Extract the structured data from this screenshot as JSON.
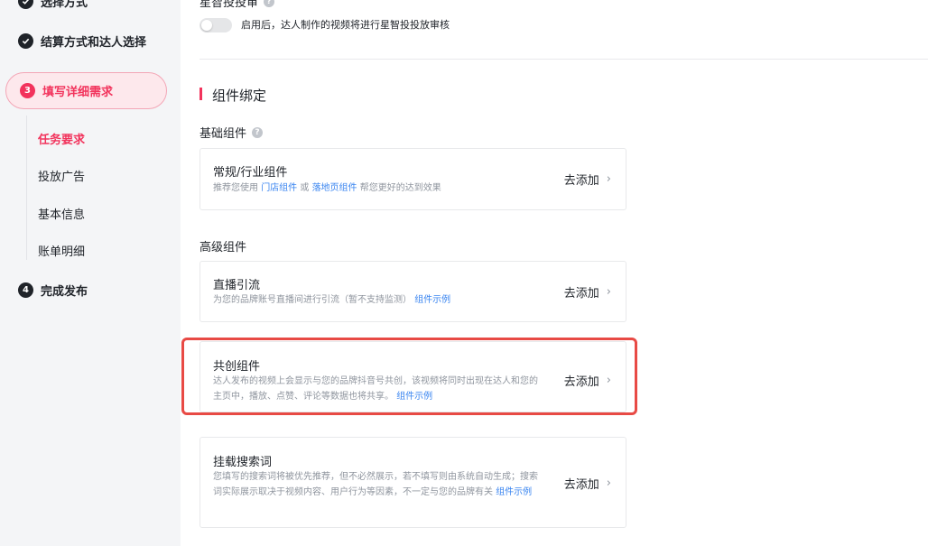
{
  "sidebar": {
    "steps": [
      {
        "label": "选择方式"
      },
      {
        "label": "结算方式和达人选择"
      },
      {
        "number": "3",
        "label": "填写详细需求"
      },
      {
        "number": "4",
        "label": "完成发布"
      }
    ],
    "sub_items": [
      {
        "label": "任务要求"
      },
      {
        "label": "投放广告"
      },
      {
        "label": "基本信息"
      },
      {
        "label": "账单明细"
      }
    ]
  },
  "main": {
    "toggle_title": "星智投投审",
    "toggle_desc": "启用后，达人制作的视频将进行星智投投放审核",
    "section_title": "组件绑定",
    "basic_label": "基础组件",
    "advanced_label": "高级组件",
    "cards": [
      {
        "title": "常规/行业组件",
        "desc_prefix": "推荐您使用",
        "link1": "门店组件",
        "or": "或",
        "link2": "落地页组件",
        "desc_suffix": "帮您更好的达到效果",
        "action": "去添加"
      },
      {
        "title": "直播引流",
        "desc": "为您的品牌账号直播间进行引流（暂不支持监测）",
        "link": "组件示例",
        "action": "去添加"
      },
      {
        "title": "共创组件",
        "desc": "达人发布的视频上会显示与您的品牌抖音号共创，该视频将同时出现在达人和您的主页中，播放、点赞、评论等数据也将共享。",
        "link": "组件示例",
        "action": "去添加"
      },
      {
        "title": "挂载搜索词",
        "desc": "您填写的搜索词将被优先推荐，但不必然展示，若不填写则由系统自动生成；搜索词实际展示取决于视频内容、用户行为等因素，不一定与您的品牌有关",
        "link": "组件示例",
        "action": "去添加"
      }
    ]
  },
  "colors": {
    "accent": "#f2335c",
    "link": "#3a85f0",
    "highlight": "#e84a45"
  }
}
